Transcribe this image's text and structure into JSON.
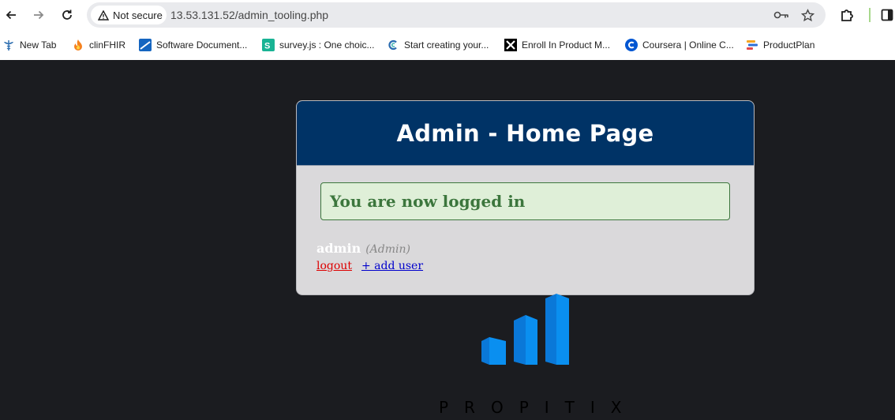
{
  "browser": {
    "security_label": "Not secure",
    "url": "13.53.131.52/admin_tooling.php",
    "bookmarks": [
      {
        "label": "New Tab",
        "icon": "caduceus-icon"
      },
      {
        "label": "clinFHIR",
        "icon": "flame-icon"
      },
      {
        "label": "Software Document...",
        "icon": "doc-site-icon"
      },
      {
        "label": "survey.js : One choic...",
        "icon": "surveyjs-icon"
      },
      {
        "label": "Start creating your...",
        "icon": "c-logo-icon"
      },
      {
        "label": "Enroll In Product M...",
        "icon": "x-logo-icon"
      },
      {
        "label": "Coursera | Online C...",
        "icon": "coursera-icon"
      },
      {
        "label": "ProductPlan",
        "icon": "productplan-icon"
      }
    ],
    "colors": {
      "toolbar": "#ffffff",
      "omnibox": "#e9eaed"
    }
  },
  "page": {
    "header_title": "Admin - Home Page",
    "success_message": "You are now logged in",
    "username": "admin",
    "role": "(Admin)",
    "logout_label": "logout",
    "add_user_label": "+ add user",
    "logo_text": "PROPITIX",
    "colors": {
      "background": "#1b1c20",
      "header": "#003366",
      "card": "#dad9db",
      "success_bg": "#dfefd8",
      "success_text": "#3c763d",
      "logout": "#dd0000",
      "add_user": "#0000cc",
      "logo_blue": "#0a8ff0"
    }
  }
}
